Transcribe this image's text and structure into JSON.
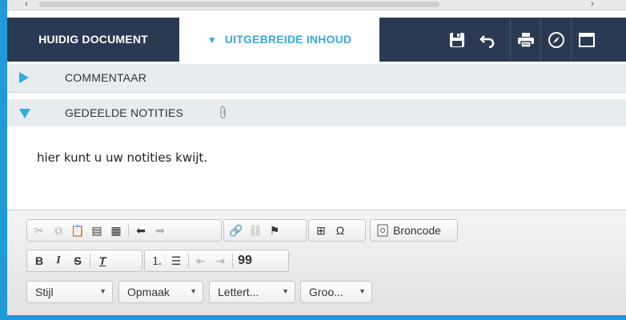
{
  "tabs": {
    "current_doc": "HUIDIG DOCUMENT",
    "extended": "UITGEBREIDE INHOUD"
  },
  "toolbar_buttons": [
    "save-icon",
    "undo-icon",
    "print-icon",
    "compass-icon",
    "window-icon"
  ],
  "sections": {
    "comments": "COMMENTAAR",
    "shared_notes": "GEDEELDE NOTITIES"
  },
  "notes": {
    "text": "hier kunt u uw notities kwijt."
  },
  "editor": {
    "source_label": "Broncode",
    "quote_label": "99",
    "combos": {
      "style": "Stijl",
      "format": "Opmaak",
      "font": "Lettert...",
      "size": "Groo..."
    }
  },
  "colors": {
    "frame": "#1f9bd7",
    "tabbar": "#2a3a53",
    "accent": "#3aa9d8",
    "section_bg": "#e7ecef"
  }
}
